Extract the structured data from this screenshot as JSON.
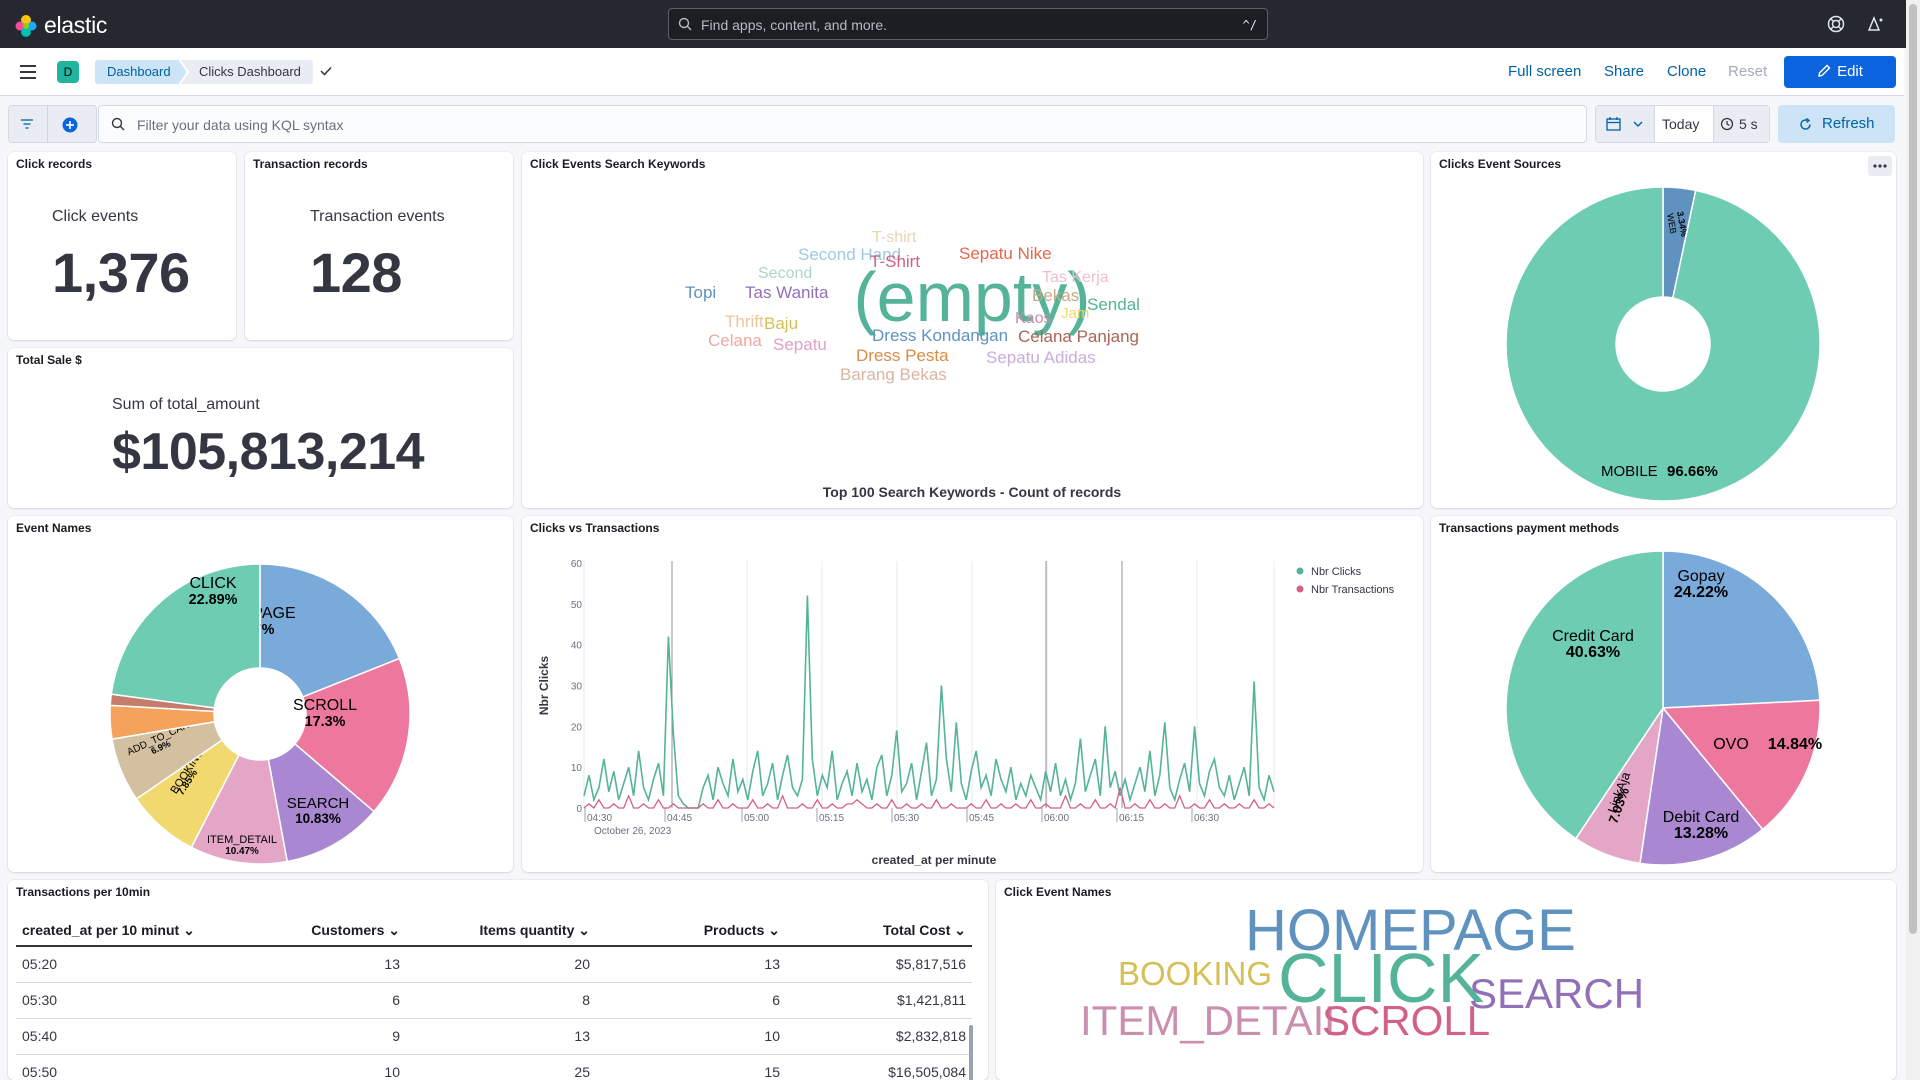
{
  "header": {
    "brand": "elastic",
    "search_placeholder": "Find apps, content, and more.",
    "search_shortcut": "^/"
  },
  "breadcrumb": {
    "space_initial": "D",
    "items": [
      "Dashboard",
      "Clicks Dashboard"
    ]
  },
  "toolbar": {
    "full_screen": "Full screen",
    "share": "Share",
    "clone": "Clone",
    "reset": "Reset",
    "edit": "Edit"
  },
  "query": {
    "placeholder": "Filter your data using KQL syntax",
    "date_label": "Today",
    "refresh_interval": "5 s",
    "refresh_label": "Refresh"
  },
  "panels": {
    "click_records": {
      "title": "Click records",
      "label": "Click events",
      "value": "1,376"
    },
    "transaction_records": {
      "title": "Transaction records",
      "label": "Transaction events",
      "value": "128"
    },
    "total_sale": {
      "title": "Total Sale $",
      "label": "Sum of total_amount",
      "value": "$105,813,214"
    },
    "search_keywords": {
      "title": "Click Events Search Keywords",
      "caption": "Top 100 Search Keywords - Count of records",
      "words": [
        {
          "text": "(empty)",
          "color": "#54b399"
        },
        {
          "text": "T-shirt",
          "color": "#e7d4b5"
        },
        {
          "text": "Second Hand",
          "color": "#9ec9e0"
        },
        {
          "text": "T-Shirt",
          "color": "#d36086"
        },
        {
          "text": "Sepatu Nike",
          "color": "#e7664c"
        },
        {
          "text": "Second",
          "color": "#a9d7ca"
        },
        {
          "text": "Tas Kerja",
          "color": "#ecbfd0"
        },
        {
          "text": "Topi",
          "color": "#6092c0"
        },
        {
          "text": "Tas Wanita",
          "color": "#9170b8"
        },
        {
          "text": "Bekas",
          "color": "#c5a987"
        },
        {
          "text": "Sendal",
          "color": "#54b399"
        },
        {
          "text": "Kaos",
          "color": "#ca8eae"
        },
        {
          "text": "Jam",
          "color": "#f1d86f"
        },
        {
          "text": "Thrift",
          "color": "#f0c59d"
        },
        {
          "text": "Baju",
          "color": "#d6bf57"
        },
        {
          "text": "Celana",
          "color": "#f0a8a2"
        },
        {
          "text": "Sepatu",
          "color": "#e3a0c4"
        },
        {
          "text": "Dress Kondangan",
          "color": "#6092c0"
        },
        {
          "text": "Celana Panjang",
          "color": "#aa6556"
        },
        {
          "text": "Dress Pesta",
          "color": "#da8b45"
        },
        {
          "text": "Sepatu Adidas",
          "color": "#c8aedc"
        },
        {
          "text": "Barang Bekas",
          "color": "#d8b5a2"
        }
      ]
    },
    "click_sources": {
      "title": "Clicks Event Sources",
      "slices": [
        {
          "label": "WEB",
          "pct": "3.34%",
          "value": 3.34,
          "color": "#6092c0"
        },
        {
          "label": "MOBILE",
          "pct": "96.66%",
          "value": 96.66,
          "color": "#6dccb1"
        }
      ]
    },
    "event_names": {
      "title": "Event Names",
      "slices": [
        {
          "label": "HOMEPAGE",
          "pct": "18.97%",
          "value": 18.97,
          "color": "#79aad9"
        },
        {
          "label": "SCROLL",
          "pct": "17.3%",
          "value": 17.3,
          "color": "#ee789d"
        },
        {
          "label": "SEARCH",
          "pct": "10.83%",
          "value": 10.83,
          "color": "#a987d1"
        },
        {
          "label": "ITEM_DETAIL",
          "pct": "10.47%",
          "value": 10.47,
          "color": "#e4a6c7"
        },
        {
          "label": "BOOKING",
          "pct": "7.85%",
          "value": 7.85,
          "color": "#f1d86f"
        },
        {
          "label": "ADD_TO_CART",
          "pct": "6.9%",
          "value": 6.9,
          "color": "#d2c0a0"
        },
        {
          "label": "",
          "pct": "",
          "value": 3.6,
          "color": "#f5a35c"
        },
        {
          "label": "",
          "pct": "",
          "value": 1.19,
          "color": "#c47c6c"
        },
        {
          "label": "CLICK",
          "pct": "22.89%",
          "value": 22.89,
          "color": "#6dccb1"
        }
      ]
    },
    "clicks_vs_tx": {
      "title": "Clicks vs Transactions"
    },
    "payment_methods": {
      "title": "Transactions payment methods",
      "slices": [
        {
          "label": "Gopay",
          "pct": "24.22%",
          "value": 24.22,
          "color": "#79aad9"
        },
        {
          "label": "OVO",
          "pct": "14.84%",
          "value": 14.84,
          "color": "#ee789d"
        },
        {
          "label": "Debit Card",
          "pct": "13.28%",
          "value": 13.28,
          "color": "#a987d1"
        },
        {
          "label": "LinkAja",
          "pct": "7.03%",
          "value": 7.03,
          "color": "#e4a6c7"
        },
        {
          "label": "Credit Card",
          "pct": "40.63%",
          "value": 40.63,
          "color": "#6dccb1"
        }
      ]
    },
    "tx_per_10min": {
      "title": "Transactions per 10min",
      "columns": [
        "created_at per 10 minut",
        "Customers",
        "Items quantity",
        "Products",
        "Total Cost"
      ],
      "rows": [
        [
          "05:20",
          "13",
          "20",
          "13",
          "$5,817,516"
        ],
        [
          "05:30",
          "6",
          "8",
          "6",
          "$1,421,811"
        ],
        [
          "05:40",
          "9",
          "13",
          "10",
          "$2,832,818"
        ],
        [
          "05:50",
          "10",
          "25",
          "15",
          "$16,505,084"
        ]
      ]
    },
    "click_event_names": {
      "title": "Click Event Names",
      "words": [
        {
          "text": "HOMEPAGE",
          "color": "#6092c0"
        },
        {
          "text": "BOOKING",
          "color": "#d6bf57"
        },
        {
          "text": "CLICK",
          "color": "#54b399"
        },
        {
          "text": "SEARCH",
          "color": "#9170b8"
        },
        {
          "text": "ITEM_DETAIL",
          "color": "#ca8eae"
        },
        {
          "text": "SCROLL",
          "color": "#d36086"
        }
      ]
    }
  },
  "chart_data": {
    "type": "line",
    "xlabel": "created_at per minute",
    "ylabel": "Nbr Clicks",
    "x_ticks": [
      "04:30",
      "04:45",
      "05:00",
      "05:15",
      "05:30",
      "05:45",
      "06:00",
      "06:15",
      "06:30"
    ],
    "x_date": "October 26, 2023",
    "ylim": [
      0,
      60
    ],
    "y_ticks": [
      0,
      10,
      20,
      30,
      40,
      50,
      60
    ],
    "series": [
      {
        "name": "Nbr Clicks",
        "color": "#54b399",
        "values": [
          3,
          8,
          2,
          5,
          12,
          4,
          9,
          2,
          6,
          10,
          3,
          14,
          5,
          2,
          7,
          11,
          3,
          42,
          18,
          3,
          1,
          0,
          0,
          0,
          5,
          8,
          2,
          10,
          6,
          3,
          12,
          4,
          7,
          2,
          9,
          14,
          3,
          6,
          11,
          2,
          8,
          13,
          5,
          3,
          7,
          52,
          12,
          3,
          8,
          5,
          14,
          2,
          6,
          9,
          3,
          11,
          4,
          7,
          2,
          10,
          13,
          3,
          8,
          19,
          4,
          6,
          11,
          2,
          9,
          16,
          3,
          7,
          30,
          12,
          4,
          21,
          6,
          2,
          9,
          14,
          5,
          8,
          3,
          12,
          7,
          4,
          10,
          2,
          6,
          3,
          8,
          5,
          2,
          9,
          4,
          11,
          3,
          7,
          2,
          6,
          17,
          4,
          8,
          12,
          3,
          20,
          5,
          9,
          3,
          7,
          2,
          6,
          10,
          4,
          14,
          3,
          8,
          21,
          5,
          2,
          7,
          11,
          4,
          20,
          6,
          3,
          9,
          12,
          5,
          3,
          8,
          2,
          6,
          10,
          3,
          31,
          5,
          2,
          8,
          4
        ]
      },
      {
        "name": "Nbr Transactions",
        "color": "#d36086",
        "values": [
          0,
          1,
          0,
          2,
          0,
          0,
          1,
          0,
          0,
          3,
          0,
          0,
          1,
          0,
          0,
          2,
          0,
          0,
          1,
          0,
          0,
          0,
          0,
          0,
          1,
          0,
          0,
          2,
          0,
          0,
          1,
          0,
          0,
          0,
          2,
          0,
          0,
          1,
          0,
          0,
          3,
          0,
          0,
          0,
          1,
          0,
          0,
          2,
          0,
          0,
          1,
          0,
          0,
          1,
          1,
          2,
          1,
          0,
          0,
          1,
          0,
          0,
          2,
          0,
          0,
          1,
          0,
          0,
          1,
          0,
          0,
          2,
          0,
          0,
          1,
          0,
          0,
          0,
          1,
          0,
          0,
          2,
          0,
          0,
          1,
          0,
          0,
          1,
          0,
          0,
          2,
          0,
          0,
          1,
          0,
          0,
          0,
          3,
          0,
          0,
          1,
          0,
          0,
          2,
          0,
          0,
          1,
          0,
          5,
          0,
          0,
          1,
          0,
          0,
          2,
          0,
          0,
          1,
          0,
          0,
          3,
          0,
          0,
          1,
          0,
          0,
          2,
          0,
          0,
          1,
          0,
          0,
          1,
          0,
          0,
          2,
          0,
          0,
          1,
          0
        ]
      }
    ],
    "legend": "top-right",
    "grid": "vertical"
  }
}
